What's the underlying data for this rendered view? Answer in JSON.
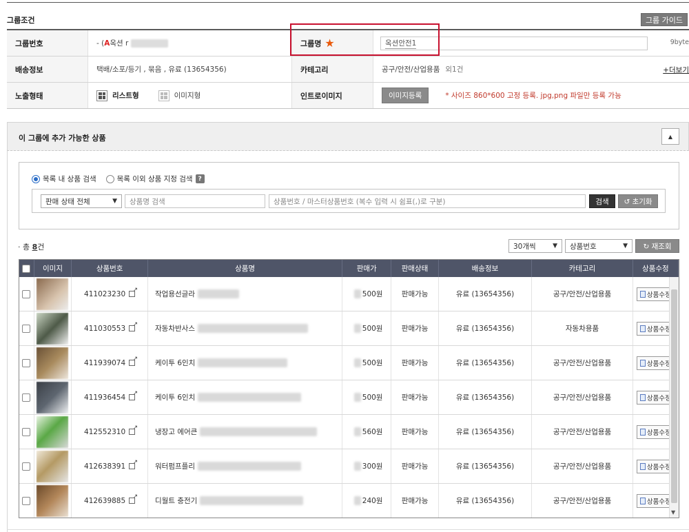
{
  "group_section": {
    "title": "그룹조건",
    "guide_button": "그룹 가이드",
    "rows": {
      "group_no_label": "그룹번호",
      "group_no_value_prefix": "- (",
      "group_no_value_a": "A",
      "group_no_value_text": "옥션 r",
      "group_name_label": "그룹명",
      "group_name_value": "옥션안전1",
      "group_name_bytes": "9byte",
      "shipping_label": "배송정보",
      "shipping_value": "택배/소포/등기 , 묶음 , 유료 (13654356)",
      "category_label": "카테고리",
      "category_value": "공구/안전/산업용품",
      "category_count": "외1건",
      "more_link": "+더보기",
      "display_label": "노출형태",
      "display_list": "리스트형",
      "display_image": "이미지형",
      "intro_label": "인트로이미지",
      "intro_button": "이미지등록",
      "intro_note": "* 사이즈 860*600 고정 등록. jpg,png 파일만 등록 가능"
    }
  },
  "addable": {
    "title": "이 그룹에 추가 가능한 상품",
    "collapse_icon": "▲"
  },
  "search": {
    "radio_in_list": "목록 내 상품 검색",
    "radio_outside": "목록 이외 상품 지정 검색",
    "help_icon": "?",
    "status_select": "판매 상태 전체",
    "name_placeholder": "상품명 검색",
    "number_placeholder": "상품번호 / 마스터상품번호 (복수 입력 시 쉼표(,)로 구분)",
    "search_button": "검색",
    "reset_button": "↺ 초기화"
  },
  "list_controls": {
    "total_prefix": "· 총 ",
    "total_count": "8",
    "total_suffix": "건",
    "per_page": "30개씩",
    "sort": "상품번호",
    "refresh_button": "↻ 재조회"
  },
  "table": {
    "headers": [
      "이미지",
      "상품번호",
      "상품명",
      "판매가",
      "판매상태",
      "배송정보",
      "카테고리",
      "상품수정"
    ],
    "edit_label": "상품수정",
    "rows": [
      {
        "no": "411023230",
        "name": "작업용선글라",
        "price": "500원",
        "status": "판매가능",
        "ship": "유료 (13654356)",
        "cat": "공구/안전/산업용품"
      },
      {
        "no": "411030553",
        "name": "자동차반사스",
        "price": "500원",
        "status": "판매가능",
        "ship": "유료 (13654356)",
        "cat": "자동차용품"
      },
      {
        "no": "411939074",
        "name": "케이투 6인치",
        "price": "500원",
        "status": "판매가능",
        "ship": "유료 (13654356)",
        "cat": "공구/안전/산업용품"
      },
      {
        "no": "411936454",
        "name": "케이투 6인치",
        "price": "500원",
        "status": "판매가능",
        "ship": "유료 (13654356)",
        "cat": "공구/안전/산업용품"
      },
      {
        "no": "412552310",
        "name": "냉장고 에어큰",
        "price": "560원",
        "status": "판매가능",
        "ship": "유료 (13654356)",
        "cat": "공구/안전/산업용품"
      },
      {
        "no": "412638391",
        "name": "워터펌프플리",
        "price": "300원",
        "status": "판매가능",
        "ship": "유료 (13654356)",
        "cat": "공구/안전/산업용품"
      },
      {
        "no": "412639885",
        "name": "디월트 충전기",
        "price": "240원",
        "status": "판매가능",
        "ship": "유료 (13654356)",
        "cat": "공구/안전/산업용품"
      }
    ]
  },
  "colors": {
    "header_bg": "#4f5568",
    "highlight": "#c8102e",
    "star": "#e95a0c",
    "note": "#c0392b"
  }
}
